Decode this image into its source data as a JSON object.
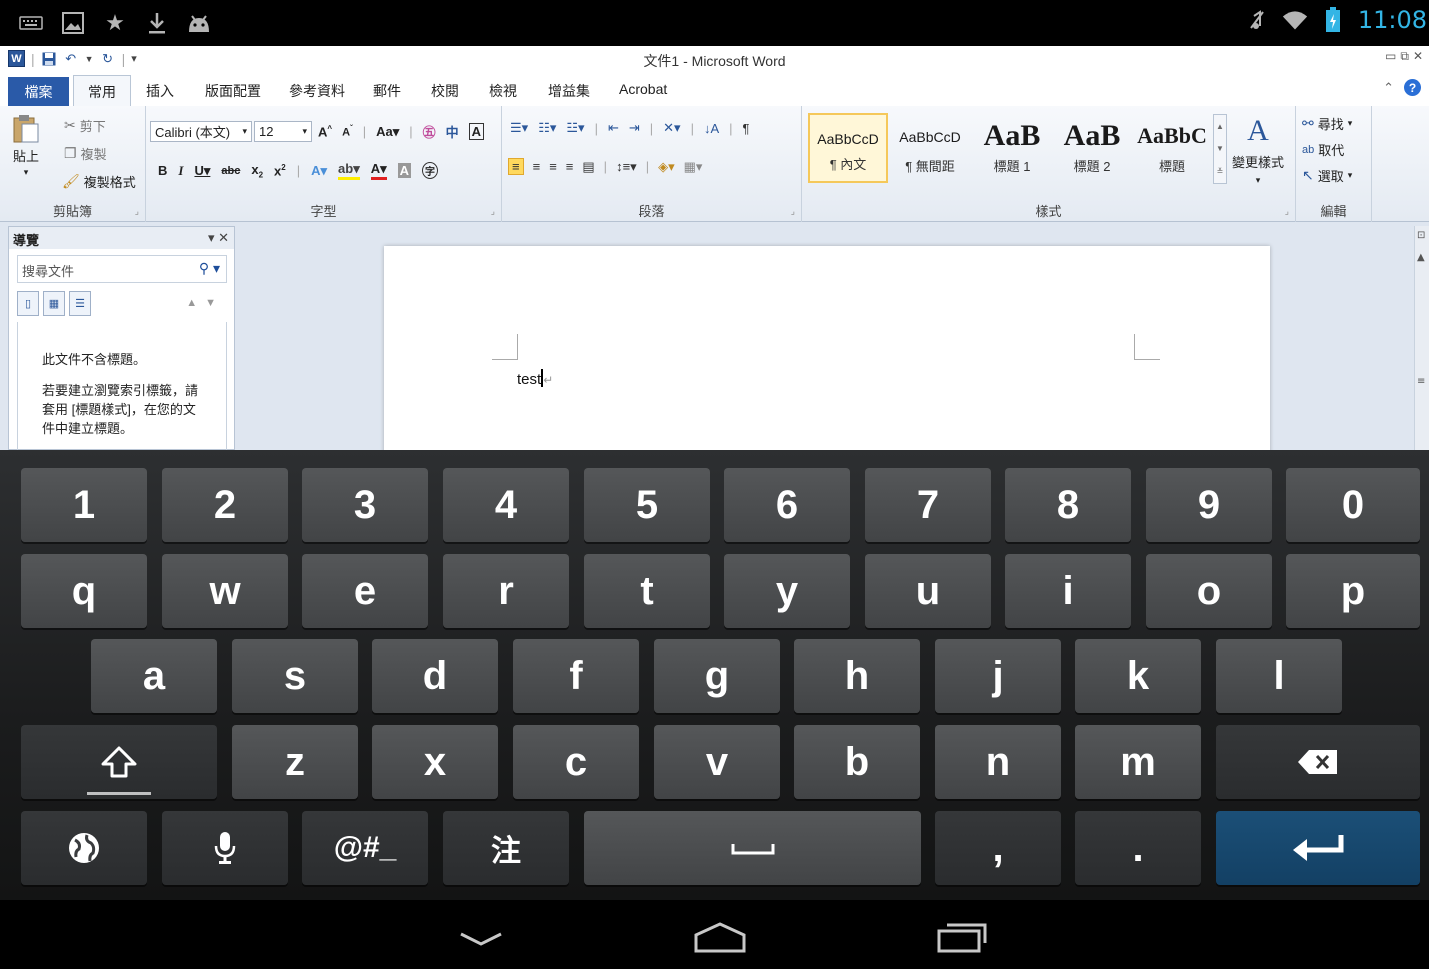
{
  "status_bar": {
    "notification_icons": [
      "keyboard-icon",
      "image-icon",
      "star-icon",
      "download-icon",
      "android-icon"
    ],
    "system_icons": [
      "mute-icon",
      "wifi-icon",
      "battery-icon"
    ],
    "clock": "11:08",
    "clock_color": "#33b5e5"
  },
  "word": {
    "title": "文件1 - Microsoft Word",
    "logo_letter": "W",
    "tabs": {
      "file": "檔案",
      "home": "常用",
      "others": [
        "插入",
        "版面配置",
        "參考資料",
        "郵件",
        "校閱",
        "檢視",
        "增益集",
        "Acrobat"
      ]
    },
    "ribbon": {
      "clipboard": {
        "paste": "貼上",
        "cut": "剪下",
        "copy": "複製",
        "format_painter": "複製格式",
        "label": "剪貼簿"
      },
      "font": {
        "font_name": "Calibri (本文)",
        "font_size": "12",
        "label": "字型"
      },
      "paragraph": {
        "label": "段落"
      },
      "styles": {
        "items": [
          {
            "sample": "AaBbCcD",
            "name": "¶ 內文"
          },
          {
            "sample": "AaBbCcD",
            "name": "¶ 無間距"
          },
          {
            "sample": "AaB",
            "name": "標題 1"
          },
          {
            "sample": "AaB",
            "name": "標題 2"
          },
          {
            "sample": "AaBbC",
            "name": "標題"
          }
        ],
        "change_styles": "變更樣式",
        "label": "樣式"
      },
      "editing": {
        "find": "尋找",
        "replace": "取代",
        "select": "選取",
        "label": "編輯"
      }
    },
    "nav_pane": {
      "title": "導覽",
      "search_placeholder": "搜尋文件",
      "message1": "此文件不含標題。",
      "message2": "若要建立瀏覽索引標籤，請套用 [標題樣式]，在您的文件中建立標題。"
    },
    "document": {
      "text": "test"
    }
  },
  "keyboard": {
    "row1": [
      "1",
      "2",
      "3",
      "4",
      "5",
      "6",
      "7",
      "8",
      "9",
      "0"
    ],
    "row2": [
      "q",
      "w",
      "e",
      "r",
      "t",
      "y",
      "u",
      "i",
      "o",
      "p"
    ],
    "row3": [
      "a",
      "s",
      "d",
      "f",
      "g",
      "h",
      "j",
      "k",
      "l"
    ],
    "row4": [
      "z",
      "x",
      "c",
      "v",
      "b",
      "n",
      "m"
    ],
    "symbols_key": "@#_",
    "zhuyin_key": "注",
    "comma_key": ",",
    "period_key": ".",
    "enter_color": "#134064"
  }
}
